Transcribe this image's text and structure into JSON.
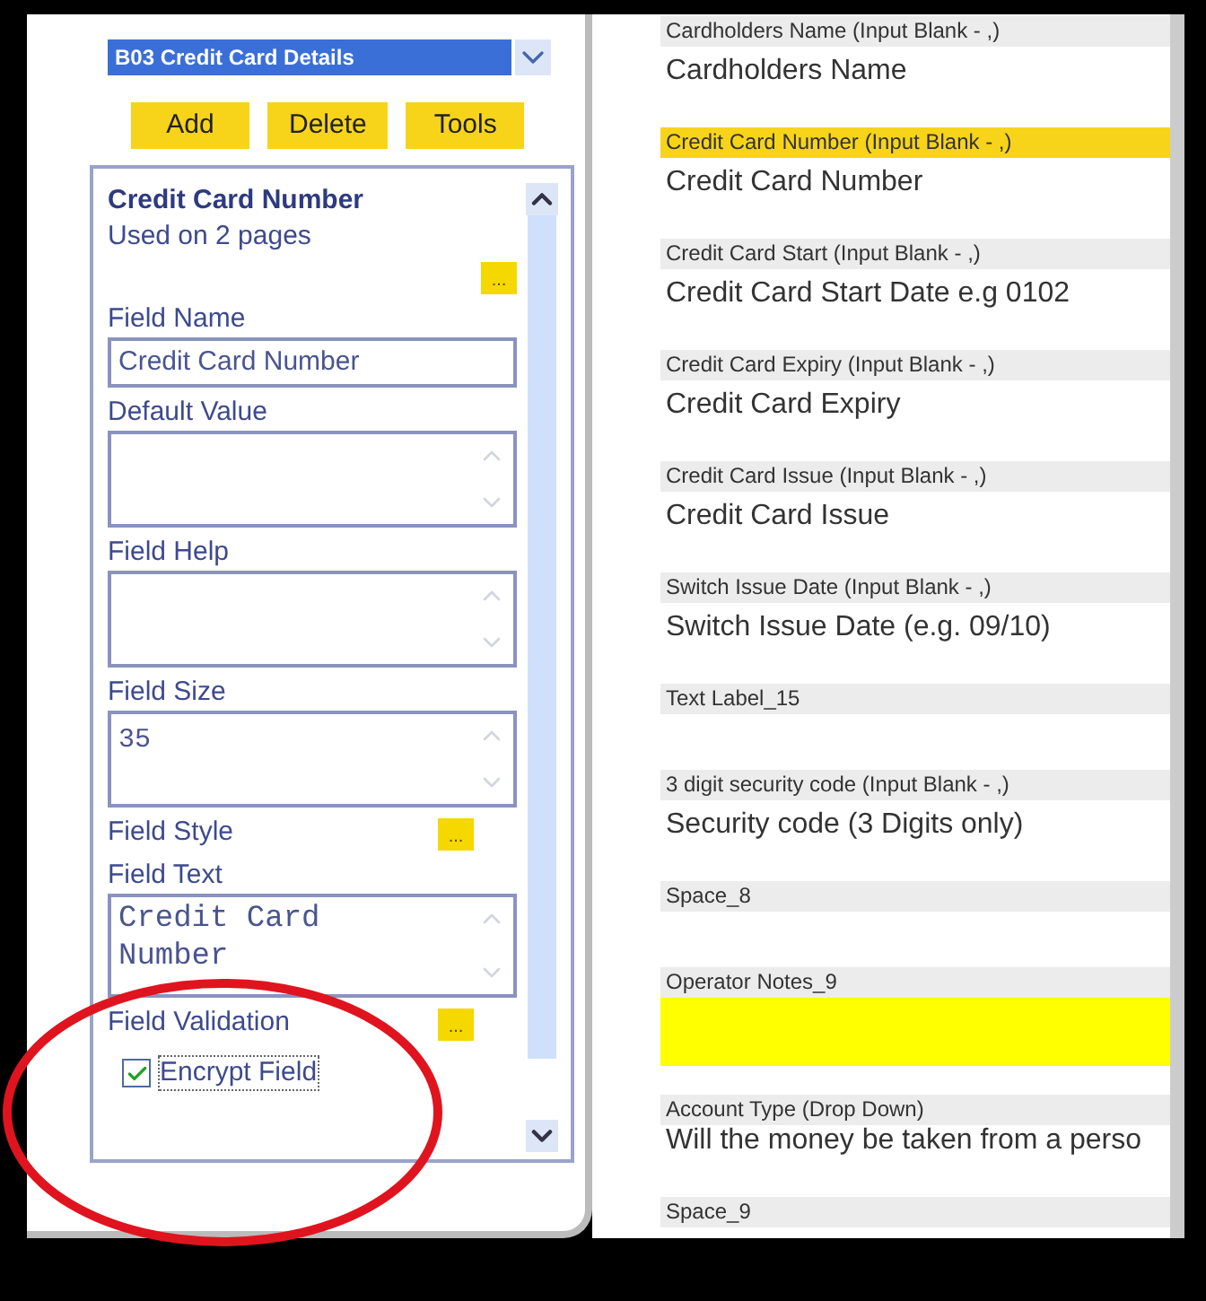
{
  "selector": {
    "value": "B03 Credit Card Details"
  },
  "toolbar": [
    "Add",
    "Delete",
    "Tools"
  ],
  "properties": {
    "title": "Credit Card Number",
    "usage": "Used on 2 pages",
    "more_button": "...",
    "fields": [
      {
        "kind": "input",
        "label": "Field Name",
        "value": "Credit Card Number"
      },
      {
        "kind": "textarea",
        "label": "Default Value"
      },
      {
        "kind": "textarea",
        "label": "Field Help"
      },
      {
        "kind": "textarea",
        "label": "Field Size",
        "value": "35"
      },
      {
        "kind": "button",
        "label": "Field Style",
        "button": "..."
      },
      {
        "kind": "code",
        "label": "Field Text",
        "value": "Credit Card Number"
      },
      {
        "kind": "button",
        "label": "Field Validation",
        "button": "..."
      },
      {
        "kind": "checkbox",
        "label": "Encrypt Field",
        "checked": true
      }
    ]
  },
  "form_items": [
    {
      "kind": "text",
      "header": "Cardholders Name (Input Blank - ,)",
      "text": "Cardholders Name",
      "selected": false
    },
    {
      "kind": "text",
      "header": "Credit Card Number (Input Blank - ,)",
      "text": "Credit Card Number",
      "selected": true
    },
    {
      "kind": "text",
      "header": "Credit Card Start (Input Blank - ,)",
      "text": "Credit Card Start Date e.g 0102",
      "selected": false
    },
    {
      "kind": "text",
      "header": "Credit Card Expiry (Input Blank - ,)",
      "text": "Credit Card Expiry",
      "selected": false
    },
    {
      "kind": "text",
      "header": "Credit Card Issue (Input Blank - ,)",
      "text": "Credit Card Issue",
      "selected": false
    },
    {
      "kind": "text",
      "header": "Switch Issue Date (Input Blank - ,)",
      "text": "Switch Issue Date (e.g. 09/10)",
      "selected": false
    },
    {
      "kind": "blank",
      "header": "Text Label_15",
      "selected": false
    },
    {
      "kind": "text",
      "header": "3 digit security code (Input Blank - ,)",
      "text": "Security code (3 Digits only)",
      "selected": false
    },
    {
      "kind": "blank",
      "header": "Space_8",
      "selected": false
    },
    {
      "kind": "note",
      "header": "Operator Notes_9",
      "selected": false
    },
    {
      "kind": "tight",
      "header": "Account Type (Drop Down)",
      "text": "Will the money be taken from a perso",
      "selected": false
    },
    {
      "kind": "blank",
      "header": "Space_9",
      "selected": false
    }
  ]
}
